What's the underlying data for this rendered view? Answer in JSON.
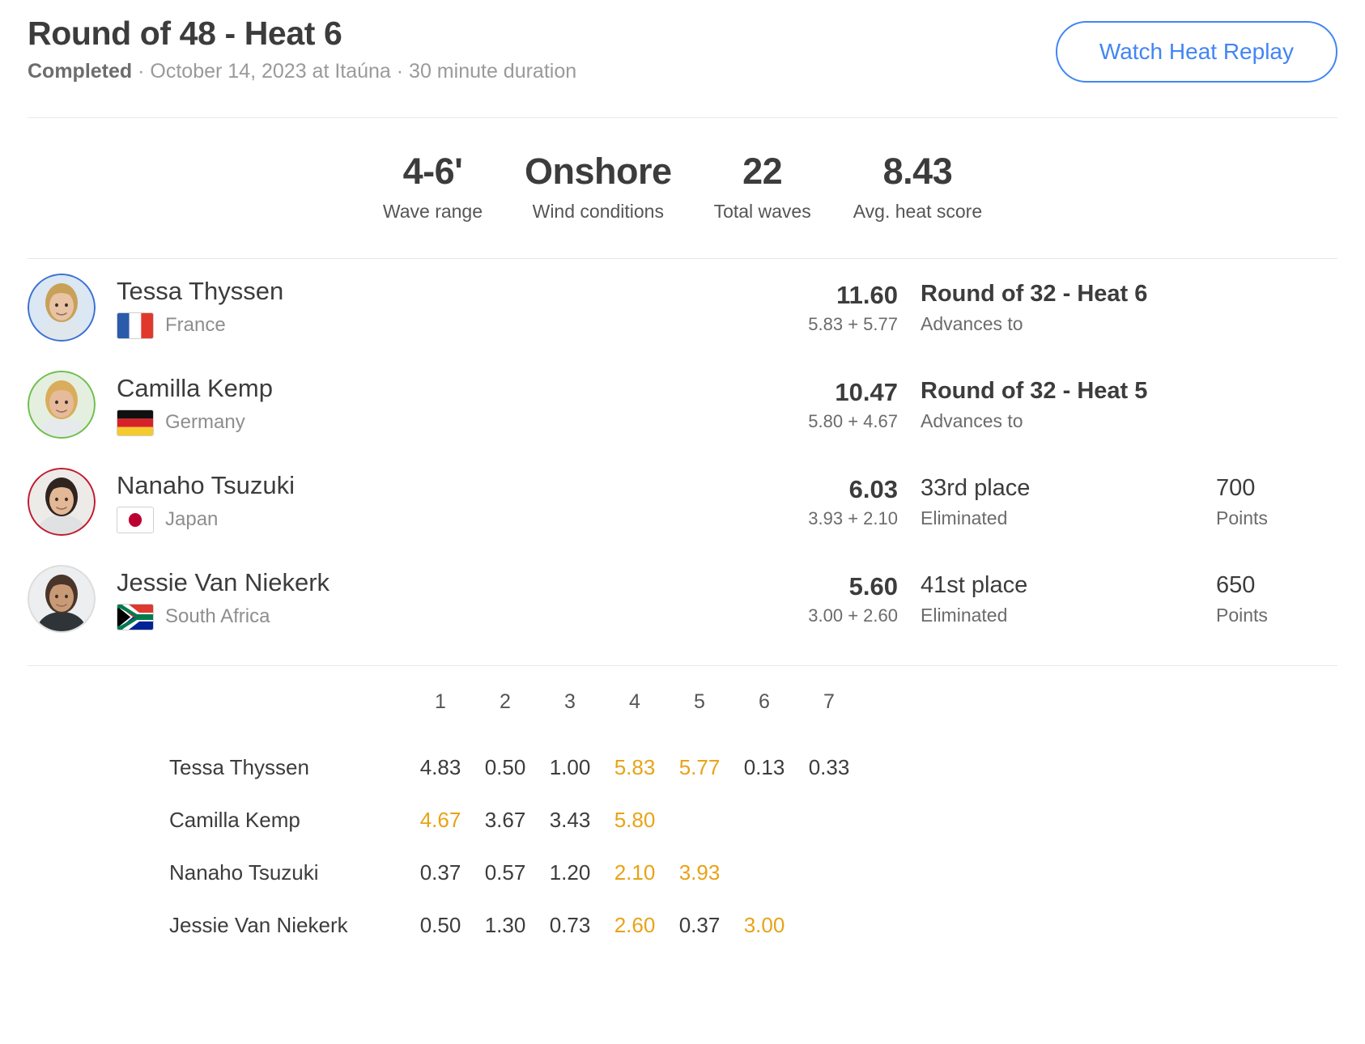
{
  "header": {
    "title": "Round of 48 - Heat 6",
    "status": "Completed",
    "subtitle_rest": " · October 14, 2023 at Itaúna · 30 minute duration",
    "replay_button": "Watch Heat Replay",
    "accent_color": "#4285f4"
  },
  "stats": [
    {
      "value": "4-6'",
      "label": "Wave range"
    },
    {
      "value": "Onshore",
      "label": "Wind conditions"
    },
    {
      "value": "22",
      "label": "Total waves"
    },
    {
      "value": "8.43",
      "label": "Avg. heat score"
    }
  ],
  "athletes": [
    {
      "name": "Tessa Thyssen",
      "country": "France",
      "flag": "france-flag",
      "ring_color": "#3b6fd4",
      "total": "11.60",
      "breakdown": "5.83 + 5.77",
      "result_title": "Round of 32 - Heat 6",
      "result_title_bold": true,
      "result_sub": "Advances to",
      "points_value": "",
      "points_label": ""
    },
    {
      "name": "Camilla Kemp",
      "country": "Germany",
      "flag": "germany-flag",
      "ring_color": "#6cc04a",
      "total": "10.47",
      "breakdown": "5.80 + 4.67",
      "result_title": "Round of 32 - Heat 5",
      "result_title_bold": true,
      "result_sub": "Advances to",
      "points_value": "",
      "points_label": ""
    },
    {
      "name": "Nanaho Tsuzuki",
      "country": "Japan",
      "flag": "japan-flag",
      "ring_color": "#c0192e",
      "total": "6.03",
      "breakdown": "3.93 + 2.10",
      "result_title": "33rd place",
      "result_title_bold": false,
      "result_sub": "Eliminated",
      "points_value": "700",
      "points_label": "Points"
    },
    {
      "name": "Jessie Van Niekerk",
      "country": "South Africa",
      "flag": "south-africa-flag",
      "ring_color": "#dddddd",
      "total": "5.60",
      "breakdown": "3.00 + 2.60",
      "result_title": "41st place",
      "result_title_bold": false,
      "result_sub": "Eliminated",
      "points_value": "650",
      "points_label": "Points"
    }
  ],
  "wave_table": {
    "columns": [
      "1",
      "2",
      "3",
      "4",
      "5",
      "6",
      "7"
    ],
    "counted_color": "#e8a317",
    "rows": [
      {
        "name": "Tessa Thyssen",
        "scores": [
          {
            "value": "4.83",
            "counted": false
          },
          {
            "value": "0.50",
            "counted": false
          },
          {
            "value": "1.00",
            "counted": false
          },
          {
            "value": "5.83",
            "counted": true
          },
          {
            "value": "5.77",
            "counted": true
          },
          {
            "value": "0.13",
            "counted": false
          },
          {
            "value": "0.33",
            "counted": false
          }
        ]
      },
      {
        "name": "Camilla Kemp",
        "scores": [
          {
            "value": "4.67",
            "counted": true
          },
          {
            "value": "3.67",
            "counted": false
          },
          {
            "value": "3.43",
            "counted": false
          },
          {
            "value": "5.80",
            "counted": true
          },
          {
            "value": "",
            "counted": false
          },
          {
            "value": "",
            "counted": false
          },
          {
            "value": "",
            "counted": false
          }
        ]
      },
      {
        "name": "Nanaho Tsuzuki",
        "scores": [
          {
            "value": "0.37",
            "counted": false
          },
          {
            "value": "0.57",
            "counted": false
          },
          {
            "value": "1.20",
            "counted": false
          },
          {
            "value": "2.10",
            "counted": true
          },
          {
            "value": "3.93",
            "counted": true
          },
          {
            "value": "",
            "counted": false
          },
          {
            "value": "",
            "counted": false
          }
        ]
      },
      {
        "name": "Jessie Van Niekerk",
        "scores": [
          {
            "value": "0.50",
            "counted": false
          },
          {
            "value": "1.30",
            "counted": false
          },
          {
            "value": "0.73",
            "counted": false
          },
          {
            "value": "2.60",
            "counted": true
          },
          {
            "value": "0.37",
            "counted": false
          },
          {
            "value": "3.00",
            "counted": true
          },
          {
            "value": "",
            "counted": false
          }
        ]
      }
    ]
  }
}
